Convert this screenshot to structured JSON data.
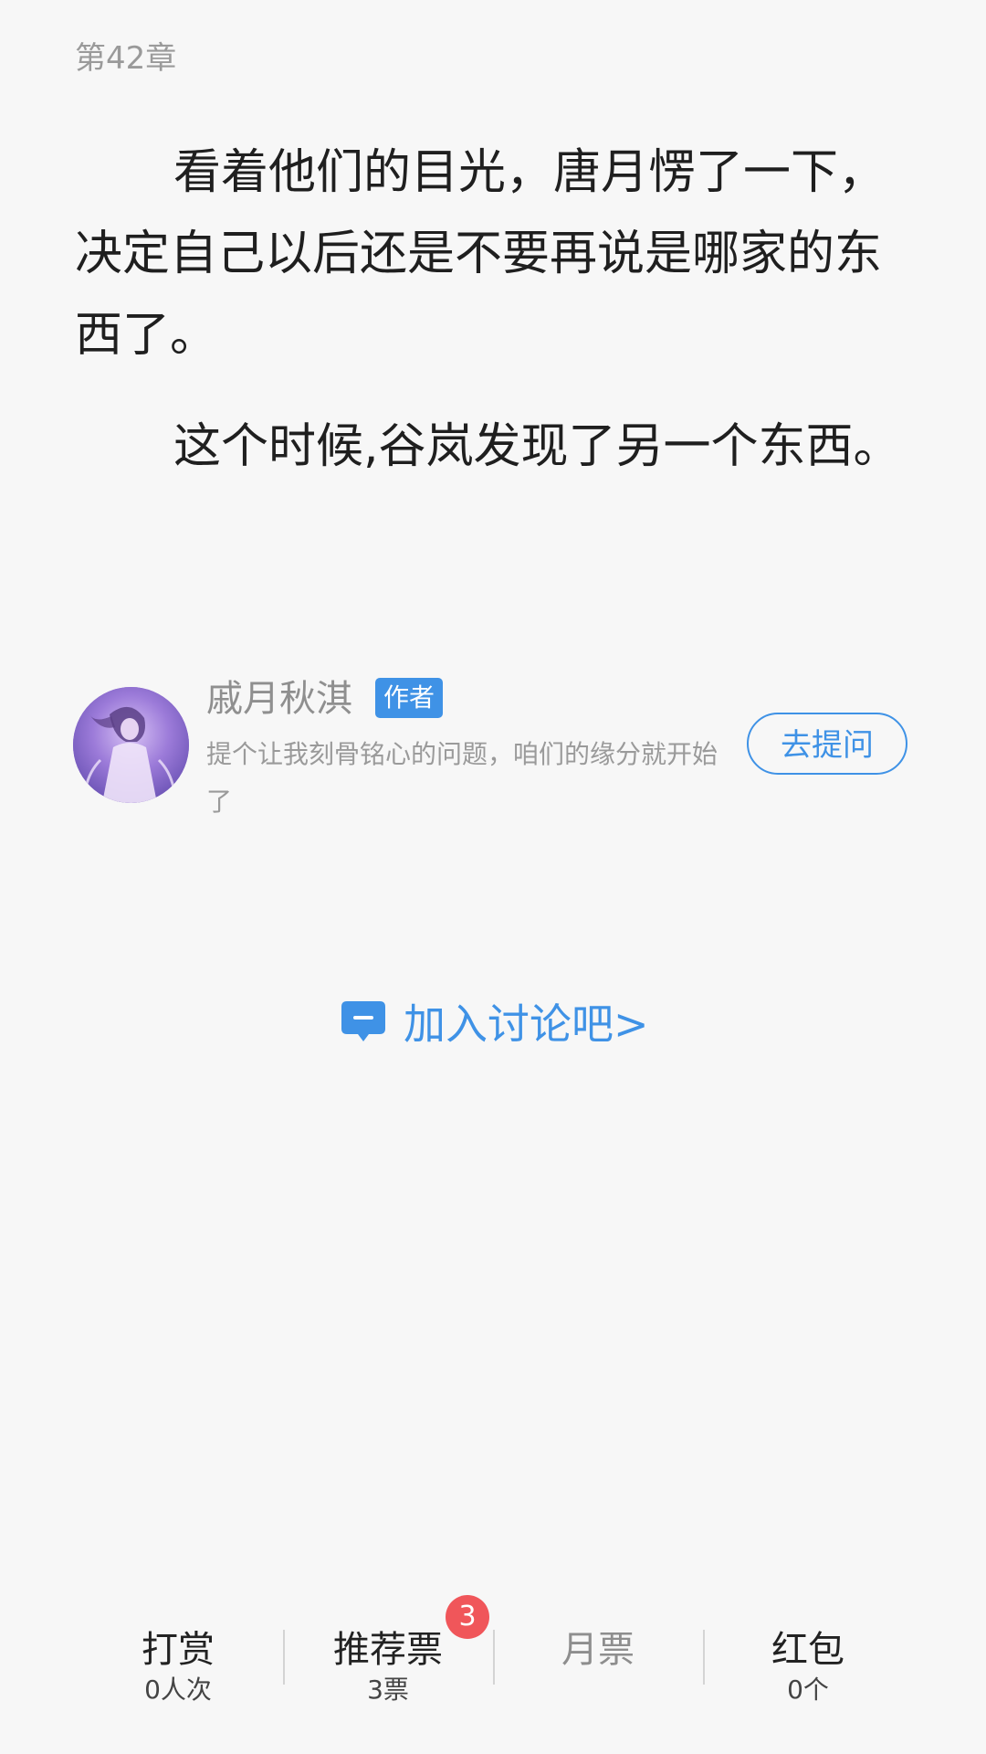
{
  "chapter": {
    "title": "第42章"
  },
  "content": {
    "paragraphs": [
      "看着他们的目光，唐月愣了一下，决定自己以后还是不要再说是哪家的东西了。",
      "这个时候,谷岚发现了另一个东西。"
    ]
  },
  "author": {
    "name": "戚月秋淇",
    "badge": "作者",
    "description": "提个让我刻骨铭心的问题，咱们的缘分就开始了",
    "ask_button": "去提问",
    "avatar_icon": "avatar-image"
  },
  "discussion": {
    "label": "加入讨论吧>",
    "icon": "chat-bubble-icon",
    "color": "#3f92e6"
  },
  "bottom_bar": {
    "items": [
      {
        "label": "打赏",
        "sub": "0人次"
      },
      {
        "label": "推荐票",
        "sub": "3票",
        "badge": "3"
      },
      {
        "label": "月票",
        "sub": ""
      },
      {
        "label": "红包",
        "sub": "0个"
      }
    ]
  },
  "colors": {
    "accent": "#3f92e6",
    "badge_red": "#f0565a",
    "background": "#f7f7f7"
  }
}
